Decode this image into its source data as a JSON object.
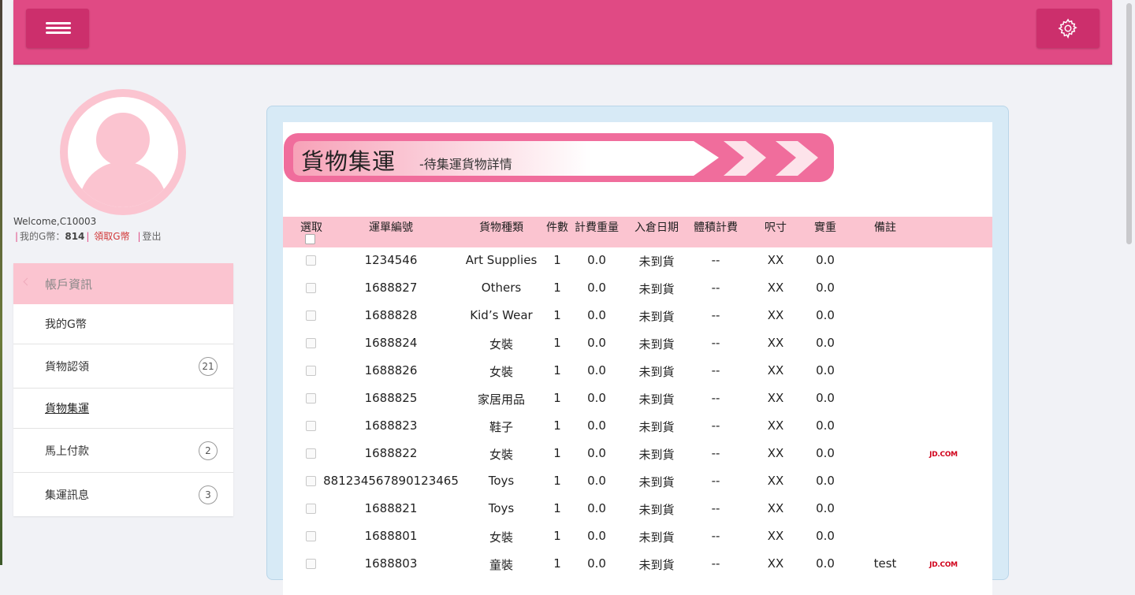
{
  "header": {
    "menu_icon": "hamburger-icon",
    "settings_icon": "gear-icon"
  },
  "profile": {
    "welcome": "Welcome,C10003",
    "coins_label": "我的G幣：",
    "coins_value": "814",
    "claim_link": "領取G幣",
    "logout": "登出"
  },
  "sidebar": {
    "header": "帳戶資訊",
    "items": [
      {
        "label": "我的G幣",
        "badge": ""
      },
      {
        "label": "貨物認領",
        "badge": "21"
      },
      {
        "label": "貨物集運",
        "badge": ""
      },
      {
        "label": "馬上付款",
        "badge": "2"
      },
      {
        "label": "集運訊息",
        "badge": "3"
      }
    ]
  },
  "banner": {
    "title": "貨物集運",
    "subtitle": "-待集運貨物詳情"
  },
  "table": {
    "columns": [
      "選取",
      "運單編號",
      "貨物種類",
      "件數",
      "計費重量",
      "入倉日期",
      "體積計費",
      "呎寸",
      "實重",
      "備註"
    ],
    "rows": [
      {
        "id": "1234546",
        "type": "Art Supplies",
        "qty": "1",
        "weight": "0.0",
        "date": "未到貨",
        "vol": "--",
        "size": "XX",
        "real": "0.0",
        "note": "",
        "jd": ""
      },
      {
        "id": "1688827",
        "type": "Others",
        "qty": "1",
        "weight": "0.0",
        "date": "未到貨",
        "vol": "--",
        "size": "XX",
        "real": "0.0",
        "note": "",
        "jd": ""
      },
      {
        "id": "1688828",
        "type": "Kid’s Wear",
        "qty": "1",
        "weight": "0.0",
        "date": "未到貨",
        "vol": "--",
        "size": "XX",
        "real": "0.0",
        "note": "",
        "jd": ""
      },
      {
        "id": "1688824",
        "type": "女裝",
        "qty": "1",
        "weight": "0.0",
        "date": "未到貨",
        "vol": "--",
        "size": "XX",
        "real": "0.0",
        "note": "",
        "jd": ""
      },
      {
        "id": "1688826",
        "type": "女裝",
        "qty": "1",
        "weight": "0.0",
        "date": "未到貨",
        "vol": "--",
        "size": "XX",
        "real": "0.0",
        "note": "",
        "jd": ""
      },
      {
        "id": "1688825",
        "type": "家居用品",
        "qty": "1",
        "weight": "0.0",
        "date": "未到貨",
        "vol": "--",
        "size": "XX",
        "real": "0.0",
        "note": "",
        "jd": ""
      },
      {
        "id": "1688823",
        "type": "鞋子",
        "qty": "1",
        "weight": "0.0",
        "date": "未到貨",
        "vol": "--",
        "size": "XX",
        "real": "0.0",
        "note": "",
        "jd": ""
      },
      {
        "id": "1688822",
        "type": "女裝",
        "qty": "1",
        "weight": "0.0",
        "date": "未到貨",
        "vol": "--",
        "size": "XX",
        "real": "0.0",
        "note": "",
        "jd": "JD.COM"
      },
      {
        "id": "881234567890123465",
        "type": "Toys",
        "qty": "1",
        "weight": "0.0",
        "date": "未到貨",
        "vol": "--",
        "size": "XX",
        "real": "0.0",
        "note": "",
        "jd": ""
      },
      {
        "id": "1688821",
        "type": "Toys",
        "qty": "1",
        "weight": "0.0",
        "date": "未到貨",
        "vol": "--",
        "size": "XX",
        "real": "0.0",
        "note": "",
        "jd": ""
      },
      {
        "id": "1688801",
        "type": "女裝",
        "qty": "1",
        "weight": "0.0",
        "date": "未到貨",
        "vol": "--",
        "size": "XX",
        "real": "0.0",
        "note": "",
        "jd": ""
      },
      {
        "id": "1688803",
        "type": "童裝",
        "qty": "1",
        "weight": "0.0",
        "date": "未到貨",
        "vol": "--",
        "size": "XX",
        "real": "0.0",
        "note": "test",
        "jd": "JD.COM"
      }
    ]
  },
  "colors": {
    "primary": "#e04a84",
    "primary_dark": "#cc2f6c",
    "pink_light": "#fbc4d0",
    "panel_blue": "#d7eaf6"
  }
}
